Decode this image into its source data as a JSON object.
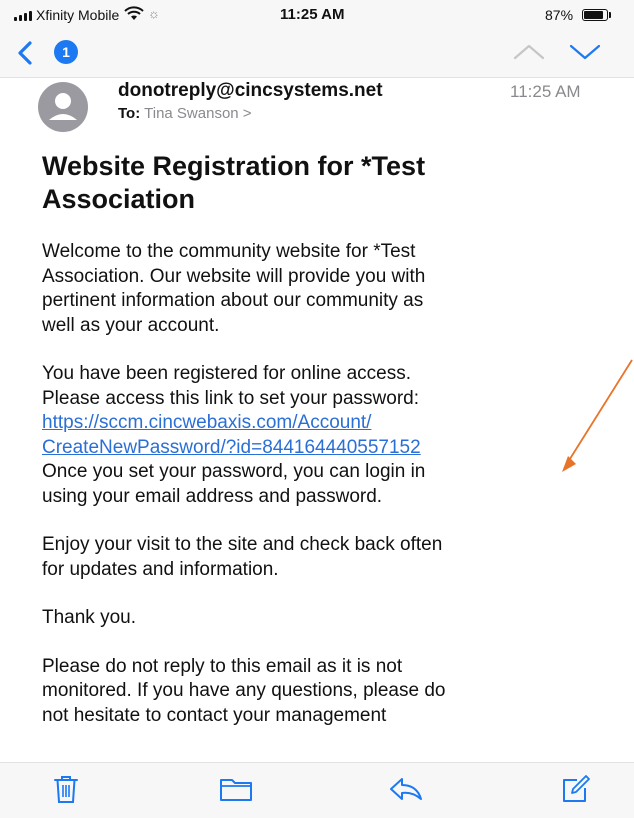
{
  "status_bar": {
    "carrier": "Xfinity Mobile",
    "time": "11:25 AM",
    "battery_percent": "87%",
    "battery_level": 0.87,
    "icons": [
      "signal-icon",
      "wifi-icon",
      "brightness-icon",
      "battery-icon"
    ]
  },
  "nav": {
    "unread_count": "1",
    "icons": [
      "back-chevron-icon",
      "up-chevron-icon",
      "down-chevron-icon"
    ]
  },
  "header": {
    "sender": "donotreply@cincsystems.net",
    "received_time": "11:25 AM",
    "to_label": "To:",
    "to_name": "Tina Swanson >"
  },
  "email": {
    "subject_line1": "Website Registration for *Test",
    "subject_line2": "Association",
    "p1_lines": [
      "Welcome to the community website for *Test",
      "Association. Our website will provide you with",
      "pertinent information about our community as",
      "well as your account."
    ],
    "p2_lines": [
      "You have been registered for online access.",
      "Please access this link to set your password:"
    ],
    "link_line1": "https://sccm.cincwebaxis.com/Account/",
    "link_line2": "CreateNewPassword/?id=844164440557152",
    "p2_after_lines": [
      "Once you set your password, you can login in",
      "using your email address and password."
    ],
    "p3_lines": [
      "Enjoy your visit to the site and check back often",
      "for updates and information."
    ],
    "p4": "Thank you.",
    "p5_lines": [
      "Please do not reply to this email as it is not",
      "monitored. If you have any questions, please do",
      "not hesitate to contact your management"
    ]
  },
  "annotation": {
    "color": "#e8742a"
  },
  "toolbar": {
    "icons": [
      "trash-icon",
      "folder-icon",
      "reply-icon",
      "compose-icon"
    ]
  },
  "colors": {
    "accent": "#1c79f2",
    "link": "#2a6fd6",
    "secondary_text": "#8a8a8e"
  }
}
